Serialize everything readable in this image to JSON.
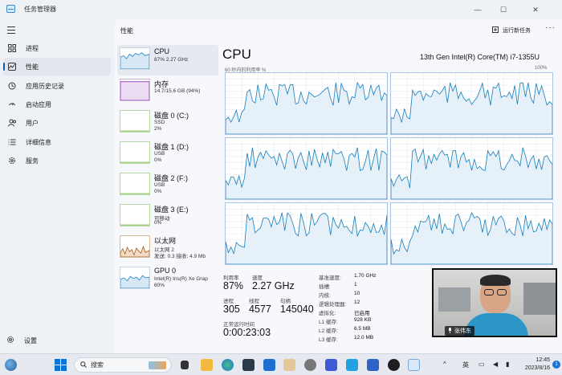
{
  "window": {
    "title": "任务管理器",
    "minimize_glyph": "—",
    "maximize_glyph": "☐",
    "close_glyph": "✕"
  },
  "sidebar": {
    "items": [
      {
        "label": "进程",
        "icon": "grid-icon"
      },
      {
        "label": "性能",
        "icon": "performance-icon",
        "active": true
      },
      {
        "label": "应用历史记录",
        "icon": "history-icon"
      },
      {
        "label": "启动应用",
        "icon": "startup-icon"
      },
      {
        "label": "用户",
        "icon": "users-icon"
      },
      {
        "label": "详细信息",
        "icon": "details-icon"
      },
      {
        "label": "服务",
        "icon": "services-icon"
      }
    ],
    "settings_label": "设置"
  },
  "header": {
    "page_title": "性能",
    "run_task_label": "运行新任务",
    "more_label": "···"
  },
  "devices": [
    {
      "name": "CPU",
      "line1": "87%  2.27 GHz",
      "line2": "",
      "active": true,
      "color": "#117dbb"
    },
    {
      "name": "内存",
      "line1": "14.7/15.6 GB (94%)",
      "line2": "",
      "color": "#8b12ae"
    },
    {
      "name": "磁盘 0 (C:)",
      "line1": "SSD",
      "line2": "2%",
      "color": "#4da60c"
    },
    {
      "name": "磁盘 1 (D:)",
      "line1": "USB",
      "line2": "0%",
      "color": "#4da60c"
    },
    {
      "name": "磁盘 2 (F:)",
      "line1": "USB",
      "line2": "0%",
      "color": "#4da60c"
    },
    {
      "name": "磁盘 3 (E:)",
      "line1": "可移动",
      "line2": "0%",
      "color": "#4da60c"
    },
    {
      "name": "以太网",
      "line1": "以太网 2",
      "line2": "发送: 0.3  接收: 4.9 Mb",
      "color": "#a74f01"
    },
    {
      "name": "GPU 0",
      "line1": "Intel(R) Iris(R) Xe Grap",
      "line2": "60%",
      "color": "#117dbb"
    }
  ],
  "detail": {
    "title": "CPU",
    "model": "13th Gen Intel(R) Core(TM) i7-1355U",
    "util_label": "60 秒内的利用率 %",
    "util_max": "100%",
    "stats": {
      "utilization_label": "利用率",
      "utilization_value": "87%",
      "speed_label": "速度",
      "speed_value": "2.27 GHz",
      "processes_label": "进程",
      "processes_value": "305",
      "threads_label": "线程",
      "threads_value": "4577",
      "handles_label": "句柄",
      "handles_value": "145040",
      "uptime_label": "正常运行时间",
      "uptime_value": "0:00:23:03"
    },
    "specs": [
      {
        "key": "基准速度:",
        "value": "1.70 GHz"
      },
      {
        "key": "插槽:",
        "value": "1"
      },
      {
        "key": "内核:",
        "value": "10"
      },
      {
        "key": "逻辑处理器:",
        "value": "12"
      },
      {
        "key": "虚拟化:",
        "value": "已启用"
      },
      {
        "key": "L1 缓存:",
        "value": "928 KB"
      },
      {
        "key": "L2 缓存:",
        "value": "6.5 MB"
      },
      {
        "key": "L3 缓存:",
        "value": "12.0 MB"
      }
    ]
  },
  "webcam": {
    "name_tag": "张伟东"
  },
  "taskbar": {
    "search_placeholder": "搜索",
    "ime_label": "英",
    "time": "12:45",
    "date": "2023/8/16",
    "notification_count": "1"
  },
  "colors": {
    "accent": "#0a5fb4",
    "cpu_line": "#117dbb",
    "graph_border": "#a9c5e3"
  }
}
